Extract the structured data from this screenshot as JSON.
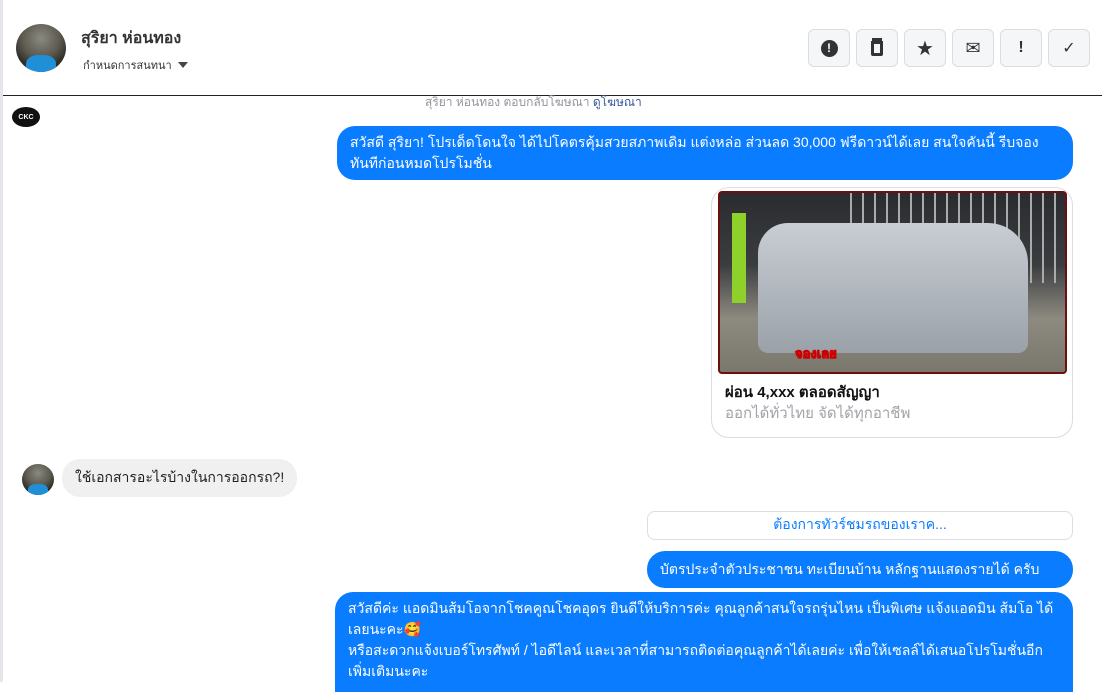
{
  "header": {
    "contact_name": "สุริยา ห่อนทอง",
    "assign_label": "กำหนดการสนทนา",
    "actions": [
      {
        "icon": "alert-circle-icon",
        "glyph": "❗"
      },
      {
        "icon": "trash-icon",
        "glyph": "🗑"
      },
      {
        "icon": "star-icon",
        "glyph": "★"
      },
      {
        "icon": "envelope-icon",
        "glyph": "✉"
      },
      {
        "icon": "exclamation-icon",
        "glyph": "!"
      },
      {
        "icon": "check-icon",
        "glyph": "✓"
      }
    ]
  },
  "system_message": {
    "text": "สุริยา ห่อนทอง ตอบกลับโฆษณา ",
    "link": "ดูโฆษณา"
  },
  "page_logo_text": "CKC",
  "messages": {
    "m1": "สวัสดี สุริยา! โปรเด็ดโดนใจ ได้ไปโคตรคุ้มสวยสภาพเดิม แต่งหล่อ  ส่วนลด 30,000 ฟรีดาวน์ได้เลย  สนใจคันนี้ รีบจองทันทีก่อนหมดโปรโมชั่น",
    "card": {
      "badge": "จองเลย",
      "title": "ผ่อน 4,xxx ตลอดสัญญา",
      "subtitle": "ออกได้ทั่วไทย จัดได้ทุกอาชีพ"
    },
    "incoming": "ใช้เอกสารอะไรบ้างในการออกรถ?!",
    "quick_reply": "ต้องการทัวร์ชมรถของเราค...",
    "m2": "บัตรประจำตัวประชาชน ทะเบียนบ้าน หลักฐานแสดงรายได้ ครับ",
    "m3_line1": "สวัสดีค่ะ แอดมินส้มโอจากโชคคูณโชคอุดร ยินดีให้บริการค่ะ   คุณลูกค้าสนใจรถรุ่นไหน เป็นพิเศษ แจ้งแอดมิน ส้มโอ ได้เลยนะคะ🥰",
    "m3_line2": "หรือสะดวกแจ้งเบอร์โทรศัพท์ / ไอดีไลน์ และเวลาที่สามารถติดต่อคุณลูกค้าได้เลยค่ะ เพื่อให้เซลล์ได้เสนอโปรโมชั่นอีกเพิ่มเติมนะคะ"
  },
  "colors": {
    "accent": "#0a7cff"
  }
}
